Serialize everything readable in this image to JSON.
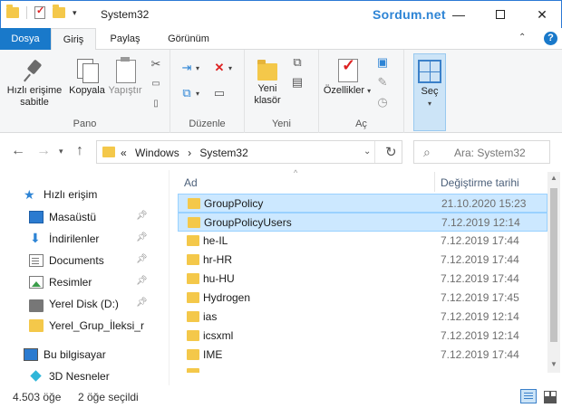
{
  "window": {
    "title": "System32",
    "brand": "Sordum.net",
    "minimize": "—",
    "close": "✕"
  },
  "ribbon_tabs": [
    "Dosya",
    "Giriş",
    "Paylaş",
    "Görünüm"
  ],
  "ribbon": {
    "pin_label": "Hızlı erişime sabitle",
    "copy_label": "Kopyala",
    "paste_label": "Yapıştır",
    "group_pano": "Pano",
    "group_duzenle": "Düzenle",
    "new_folder_label": "Yeni klasör",
    "group_yeni": "Yeni",
    "properties_label": "Özellikler",
    "group_ac": "Aç",
    "select_label": "Seç"
  },
  "address": {
    "prefix": "«",
    "crumbs": [
      "Windows",
      "System32"
    ],
    "separator": "›"
  },
  "search": {
    "placeholder": "Ara: System32"
  },
  "nav_pane": {
    "quick_access": "Hızlı erişim",
    "items": [
      {
        "label": "Masaüstü",
        "icon": "desktop-icon"
      },
      {
        "label": "İndirilenler",
        "icon": "downloads-icon"
      },
      {
        "label": "Documents",
        "icon": "documents-icon"
      },
      {
        "label": "Resimler",
        "icon": "pictures-icon"
      },
      {
        "label": "Yerel Disk (D:)",
        "icon": "drive-icon"
      },
      {
        "label": "Yerel_Grup_İleksi_r",
        "icon": "folder-icon"
      }
    ],
    "this_pc": "Bu bilgisayar",
    "objects_3d": "3D Nesneler"
  },
  "columns": {
    "name": "Ad",
    "date": "Değiştirme tarihi"
  },
  "files": [
    {
      "name": "GroupPolicy",
      "date": "21.10.2020 15:23",
      "selected": true
    },
    {
      "name": "GroupPolicyUsers",
      "date": "7.12.2019 12:14",
      "selected": true
    },
    {
      "name": "he-IL",
      "date": "7.12.2019 17:44",
      "selected": false
    },
    {
      "name": "hr-HR",
      "date": "7.12.2019 17:44",
      "selected": false
    },
    {
      "name": "hu-HU",
      "date": "7.12.2019 17:44",
      "selected": false
    },
    {
      "name": "Hydrogen",
      "date": "7.12.2019 17:45",
      "selected": false
    },
    {
      "name": "ias",
      "date": "7.12.2019 12:14",
      "selected": false
    },
    {
      "name": "icsxml",
      "date": "7.12.2019 12:14",
      "selected": false
    },
    {
      "name": "IME",
      "date": "7.12.2019 17:44",
      "selected": false
    }
  ],
  "status": {
    "item_count": "4.503 öğe",
    "selected_count": "2 öğe seçildi"
  },
  "colors": {
    "accent": "#1979ca",
    "selection_bg": "#cce8ff",
    "folder": "#f4c84a"
  }
}
